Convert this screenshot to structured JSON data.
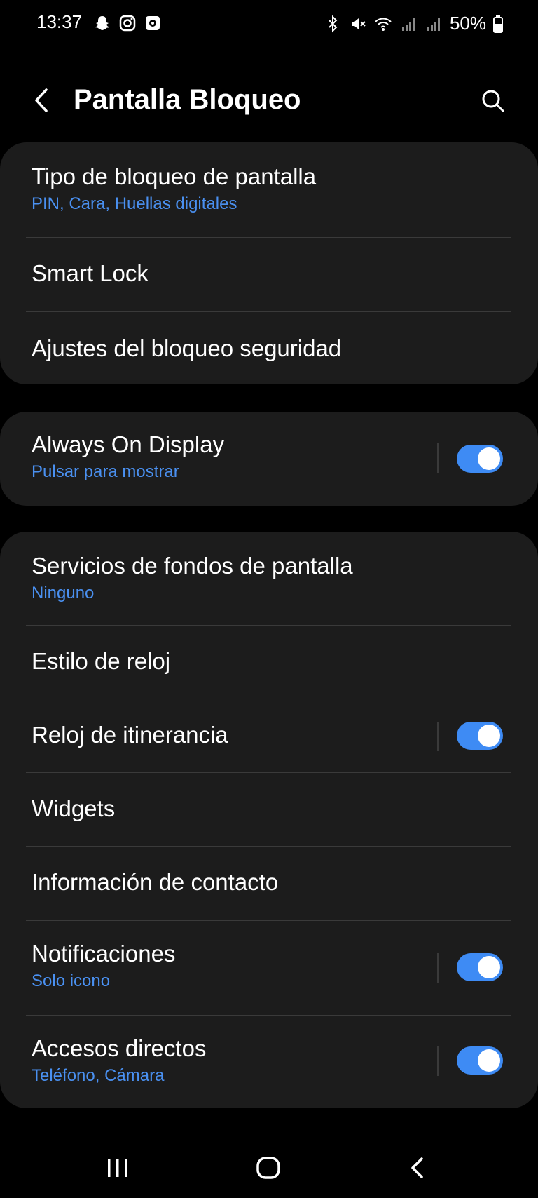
{
  "status_bar": {
    "time": "13:37",
    "battery": "50%",
    "left_icons": [
      "snapchat-icon",
      "instagram-icon",
      "app-notification-icon"
    ],
    "right_icons": [
      "bluetooth-icon",
      "mute-icon",
      "wifi-icon",
      "signal-icon",
      "signal-icon",
      "battery-icon"
    ]
  },
  "header": {
    "title": "Pantalla Bloqueo",
    "back_icon": "back-chevron-icon",
    "search_icon": "search-icon"
  },
  "groups": [
    {
      "items": [
        {
          "label": "Tipo de bloqueo de pantalla",
          "sub": "PIN, Cara, Huellas digitales"
        },
        {
          "label": "Smart Lock"
        },
        {
          "label": "Ajustes del bloqueo seguridad"
        }
      ]
    },
    {
      "items": [
        {
          "label": "Always On Display",
          "sub": "Pulsar para mostrar",
          "toggle": true
        }
      ]
    },
    {
      "items": [
        {
          "label": "Servicios de fondos de pantalla",
          "sub": "Ninguno"
        },
        {
          "label": "Estilo de reloj"
        },
        {
          "label": "Reloj de itinerancia",
          "toggle": true
        },
        {
          "label": "Widgets"
        },
        {
          "label": "Información de contacto"
        },
        {
          "label": "Notificaciones",
          "sub": "Solo icono",
          "toggle": true
        },
        {
          "label": "Accesos directos",
          "sub": "Teléfono, Cámara",
          "toggle": true
        }
      ]
    }
  ],
  "nav_bar": [
    "recents-icon",
    "home-icon",
    "back-icon"
  ],
  "colors": {
    "background": "#000000",
    "card": "#1c1c1c",
    "accent": "#3e8bf4",
    "subtext": "#4a90f0"
  }
}
